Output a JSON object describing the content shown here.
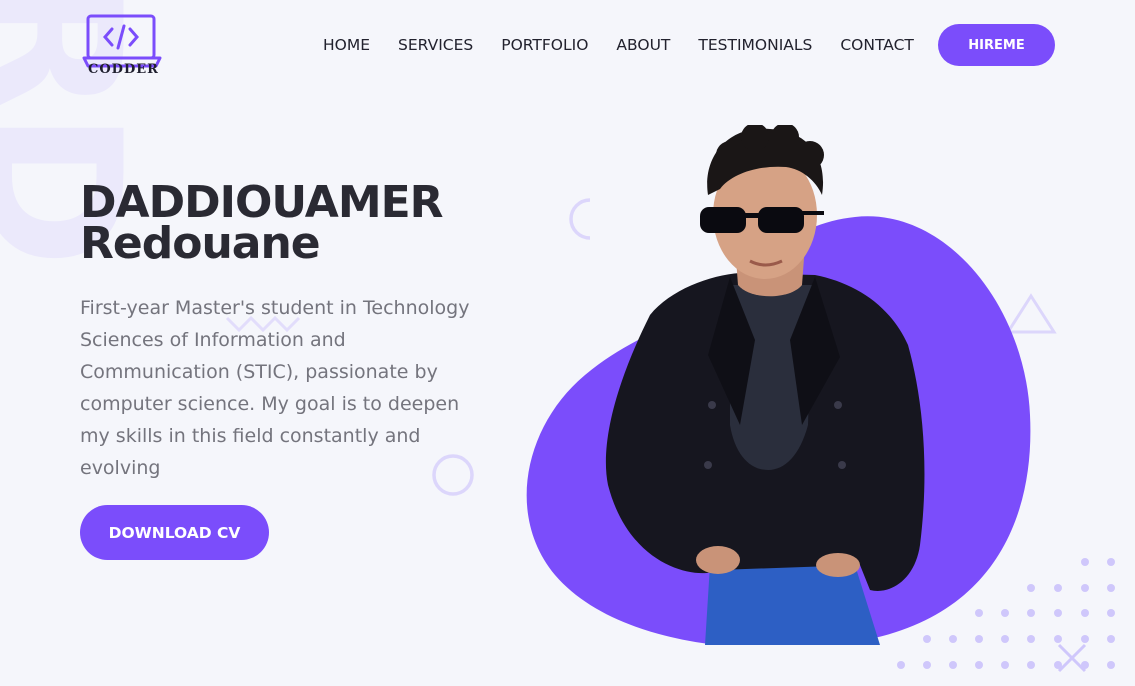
{
  "watermark": "RD",
  "logo": {
    "text": "CODDER",
    "icon": "code-laptop-icon"
  },
  "nav": {
    "items": [
      {
        "label": "HOME"
      },
      {
        "label": "SERVICES"
      },
      {
        "label": "PORTFOLIO"
      },
      {
        "label": "ABOUT"
      },
      {
        "label": "TESTIMONIALS"
      },
      {
        "label": "CONTACT"
      }
    ],
    "hire_label": "HIREME"
  },
  "hero": {
    "name_line1": "DADDIOUAMER",
    "name_line2": "Redouane",
    "description": "First-year Master's student in Technology Sciences of Information and Communication (STIC), passionate by computer science. My goal is to deepen my skills in this field constantly and evolving",
    "cv_label": "DOWNLOAD CV"
  },
  "colors": {
    "accent": "#7b4dfb",
    "background": "#f5f6fb",
    "heading": "#2a2a33",
    "body_text": "#74747d"
  }
}
